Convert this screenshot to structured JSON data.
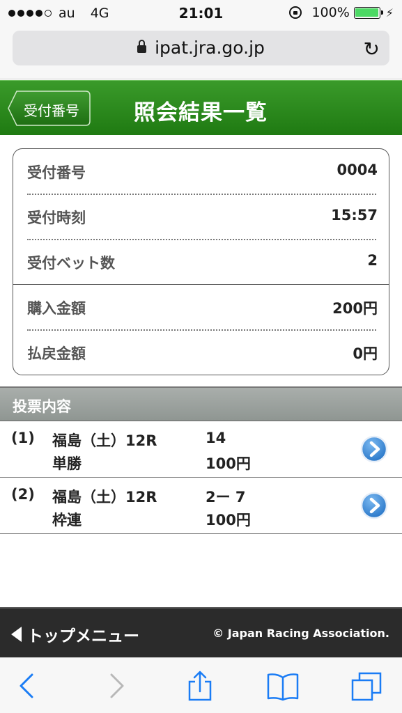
{
  "status_bar": {
    "carrier": "au",
    "network": "4G",
    "time": "21:01",
    "battery": "100%",
    "battery_level": 1.0
  },
  "browser": {
    "url": "ipat.jra.go.jp"
  },
  "header": {
    "back_label": "受付番号",
    "title": "照会結果一覧"
  },
  "summary": [
    {
      "label": "受付番号",
      "value": "0004"
    },
    {
      "label": "受付時刻",
      "value": "15:57"
    },
    {
      "label": "受付ベット数",
      "value": "2"
    },
    {
      "label": "購入金額",
      "value": "200円"
    },
    {
      "label": "払戻金額",
      "value": "0円"
    }
  ],
  "section": {
    "title": "投票内容"
  },
  "bets": [
    {
      "num": "(1)",
      "race": "福島（土）12R",
      "combo": "14",
      "type": "単勝",
      "amount": "100円"
    },
    {
      "num": "(2)",
      "race": "福島（土）12R",
      "combo": "2ー 7",
      "type": "枠連",
      "amount": "100円"
    }
  ],
  "footer": {
    "menu": "トップメニュー",
    "copyright": "© Japan Racing Association."
  },
  "colors": {
    "header_green": "#2a8a1c",
    "arrow_blue": "#2a7fd4"
  }
}
